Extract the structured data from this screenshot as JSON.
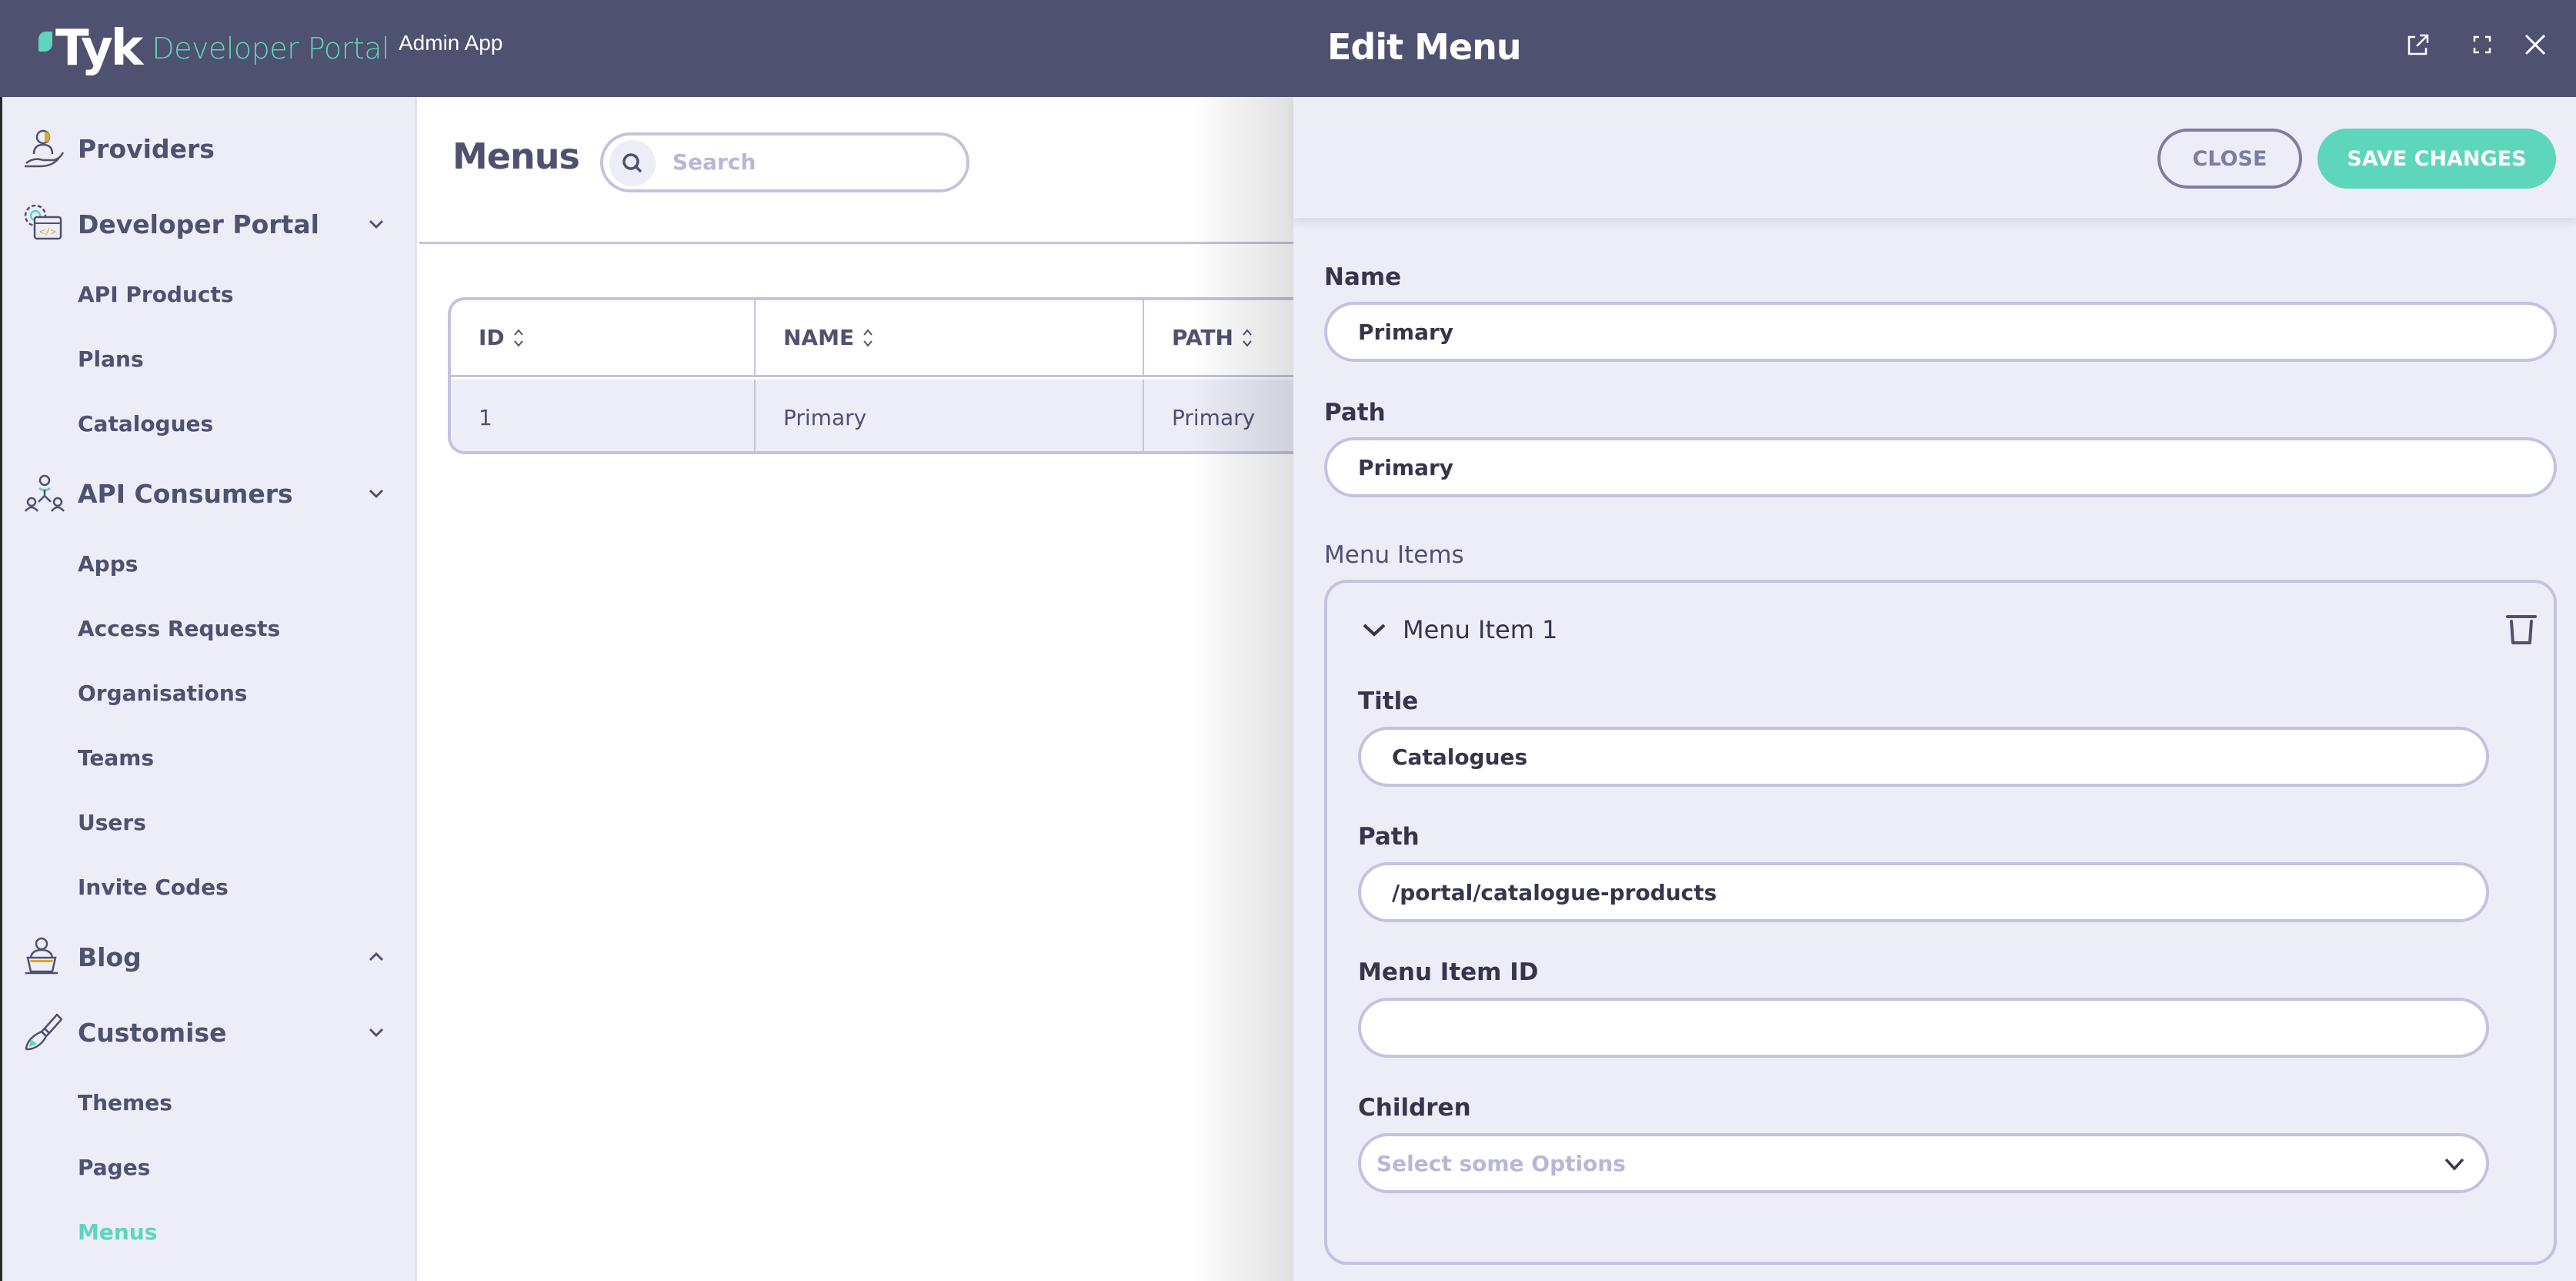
{
  "header": {
    "logo_brand": "Tyk",
    "logo_product": "Developer Portal",
    "app_name": "Admin App"
  },
  "colors": {
    "header_bg": "#4f5170",
    "accent": "#5dd6bb",
    "sidebar_bg": "#ecedf7",
    "border": "#c2c3df",
    "text": "#4f5170"
  },
  "sidebar": {
    "groups": [
      {
        "label": "Providers",
        "icon": "provider-hand-icon",
        "chevron": null,
        "items": []
      },
      {
        "label": "Developer Portal",
        "icon": "developer-portal-icon",
        "chevron": "down",
        "items": [
          "API Products",
          "Plans",
          "Catalogues"
        ]
      },
      {
        "label": "API Consumers",
        "icon": "api-consumers-icon",
        "chevron": "down",
        "items": [
          "Apps",
          "Access Requests",
          "Organisations",
          "Teams",
          "Users",
          "Invite Codes"
        ]
      },
      {
        "label": "Blog",
        "icon": "blog-laptop-icon",
        "chevron": "up",
        "items": []
      },
      {
        "label": "Customise",
        "icon": "paintbrush-icon",
        "chevron": "down",
        "items": [
          "Themes",
          "Pages",
          "Menus"
        ]
      }
    ],
    "active_item": "Menus"
  },
  "main": {
    "title": "Menus",
    "search": {
      "placeholder": "Search",
      "value": ""
    },
    "table": {
      "columns": [
        "ID",
        "NAME",
        "PATH"
      ],
      "rows": [
        {
          "id": "1",
          "name": "Primary",
          "path": "Primary"
        }
      ]
    }
  },
  "panel": {
    "title": "Edit Menu",
    "header_icons": [
      "open-external-icon",
      "fullscreen-icon",
      "close-icon"
    ],
    "close_label": "CLOSE",
    "save_label": "SAVE CHANGES",
    "fields": {
      "name": {
        "label": "Name",
        "value": "Primary"
      },
      "path": {
        "label": "Path",
        "value": "Primary"
      }
    },
    "menu_items_label": "Menu Items",
    "menu_items": [
      {
        "header": "Menu Item 1",
        "expanded": true,
        "title": {
          "label": "Title",
          "value": "Catalogues"
        },
        "path": {
          "label": "Path",
          "value": "/portal/catalogue-products"
        },
        "menu_item_id": {
          "label": "Menu Item ID",
          "value": ""
        },
        "children": {
          "label": "Children",
          "placeholder": "Select some Options"
        }
      }
    ]
  }
}
